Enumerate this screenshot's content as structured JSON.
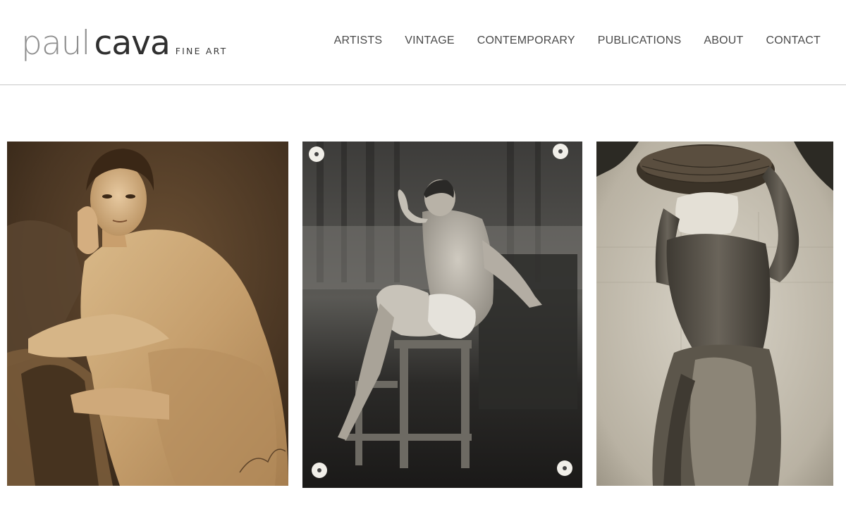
{
  "brand": {
    "name_first": "paul",
    "name_last": "cava",
    "tagline": "FINE ART"
  },
  "nav": {
    "items": [
      {
        "label": "ARTISTS"
      },
      {
        "label": "VINTAGE"
      },
      {
        "label": "CONTEMPORARY"
      },
      {
        "label": "PUBLICATIONS"
      },
      {
        "label": "ABOUT"
      },
      {
        "label": "CONTACT"
      }
    ]
  },
  "gallery": {
    "photos": [
      {
        "tone": "sepia"
      },
      {
        "tone": "black-and-white"
      },
      {
        "tone": "warm-grey"
      }
    ]
  },
  "colors": {
    "nav_text": "#4a4a4a",
    "logo_light": "#8f8f8f",
    "logo_dark": "#2f2f2f",
    "divider": "#c8c8c8"
  }
}
